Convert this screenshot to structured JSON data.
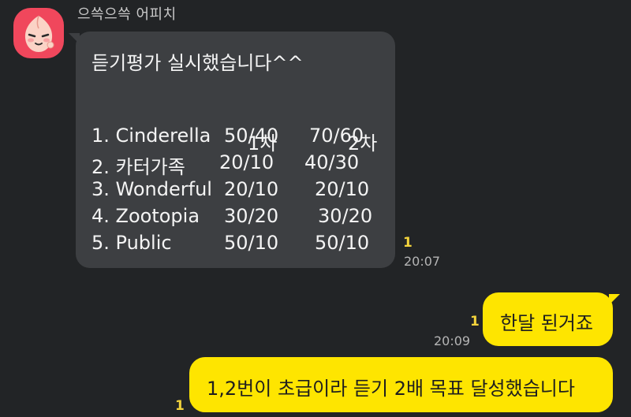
{
  "sender": {
    "name": "으쓱으쓱 어피치"
  },
  "incoming": {
    "title": "듣기평가 실시했습니다^^",
    "header": {
      "col1": "1차",
      "col2": "2차"
    },
    "rows": [
      {
        "name": "1. Cinderella",
        "r1": "50/40",
        "r2": "70/60"
      },
      {
        "name": "2. 카터가족",
        "r1": "20/10",
        "r2": "40/30"
      },
      {
        "name": "3. Wonderful",
        "r1": "20/10",
        "r2": "20/10"
      },
      {
        "name": "4. Zootopia",
        "r1": "30/20",
        "r2": "30/20"
      },
      {
        "name": "5. Public",
        "r1": "50/10",
        "r2": "50/10"
      }
    ],
    "unread": "1",
    "time": "20:07"
  },
  "outgoing": [
    {
      "text": "한달 된거죠",
      "unread": "1",
      "time": "20:09"
    },
    {
      "text": "1,2번이 초급이라 듣기 2배 목표 달성했습니다",
      "unread": "1"
    }
  ],
  "colors": {
    "background": "#222426",
    "incoming_bubble": "#3d3f42",
    "outgoing_bubble": "#fee500",
    "unread": "#f3d33c",
    "avatar": "#f0475c"
  },
  "icons": {
    "avatar": "apeach-character-icon"
  }
}
